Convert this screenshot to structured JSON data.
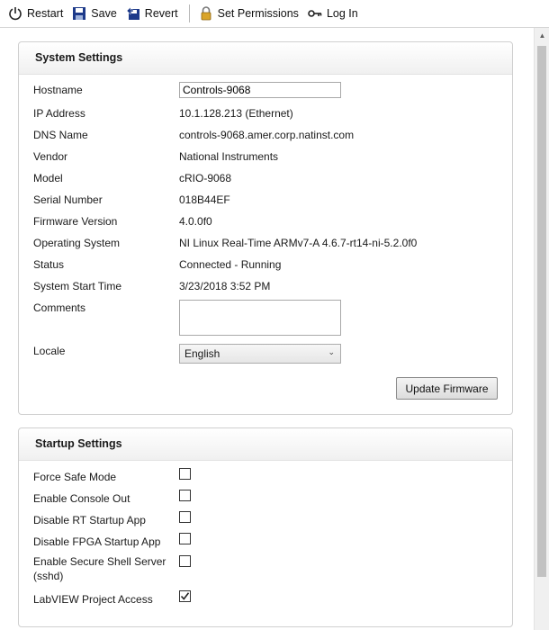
{
  "toolbar": {
    "restart_label": "Restart",
    "save_label": "Save",
    "revert_label": "Revert",
    "permissions_label": "Set Permissions",
    "login_label": "Log In"
  },
  "system": {
    "title": "System Settings",
    "hostname_label": "Hostname",
    "hostname_value": "Controls-9068",
    "ip_label": "IP Address",
    "ip_value": "10.1.128.213 (Ethernet)",
    "dns_label": "DNS Name",
    "dns_value": "controls-9068.amer.corp.natinst.com",
    "vendor_label": "Vendor",
    "vendor_value": "National Instruments",
    "model_label": "Model",
    "model_value": "cRIO-9068",
    "serial_label": "Serial Number",
    "serial_value": "018B44EF",
    "firmware_label": "Firmware Version",
    "firmware_value": "4.0.0f0",
    "os_label": "Operating System",
    "os_value": "NI Linux Real-Time ARMv7-A 4.6.7-rt14-ni-5.2.0f0",
    "status_label": "Status",
    "status_value": "Connected - Running",
    "start_label": "System Start Time",
    "start_value": "3/23/2018 3:52 PM",
    "comments_label": "Comments",
    "comments_value": "",
    "locale_label": "Locale",
    "locale_value": "English",
    "update_firmware_label": "Update Firmware"
  },
  "startup": {
    "title": "Startup Settings",
    "items": [
      {
        "label": "Force Safe Mode",
        "checked": false
      },
      {
        "label": "Enable Console Out",
        "checked": false
      },
      {
        "label": "Disable RT Startup App",
        "checked": false
      },
      {
        "label": "Disable FPGA Startup App",
        "checked": false
      },
      {
        "label": "Enable Secure Shell Server\n(sshd)",
        "checked": false
      },
      {
        "label": "LabVIEW Project Access",
        "checked": true
      }
    ]
  }
}
